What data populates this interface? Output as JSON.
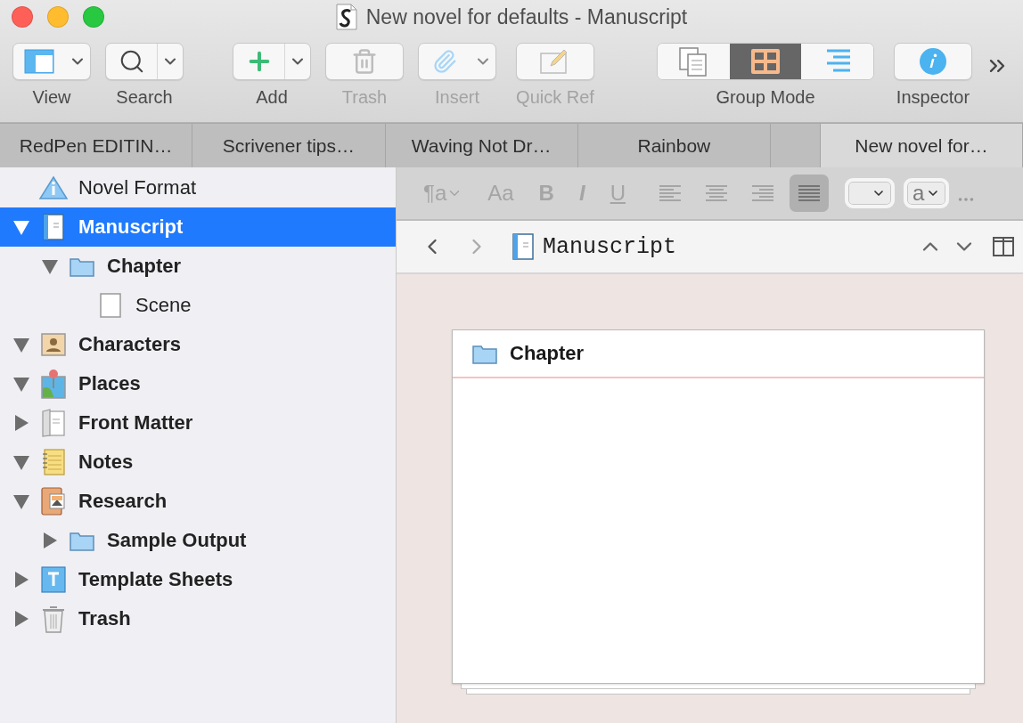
{
  "window": {
    "title": "New novel for defaults - Manuscript"
  },
  "toolbar": [
    {
      "kind": "view",
      "label": "View",
      "dropdown": true,
      "disabled": false
    },
    {
      "kind": "search",
      "label": "Search",
      "dropdown": true,
      "disabled": false
    },
    {
      "kind": "add",
      "label": "Add",
      "dropdown": true,
      "disabled": false
    },
    {
      "kind": "trash",
      "label": "Trash",
      "dropdown": false,
      "disabled": true
    },
    {
      "kind": "insert",
      "label": "Insert",
      "dropdown": true,
      "disabled": true
    },
    {
      "kind": "quickref",
      "label": "Quick Ref",
      "dropdown": false,
      "disabled": true
    },
    {
      "kind": "group",
      "label": "Group Mode",
      "segments": [
        {
          "kind": "scrivenings",
          "selected": false
        },
        {
          "kind": "corkboard",
          "selected": true
        },
        {
          "kind": "outliner",
          "selected": false
        }
      ]
    },
    {
      "kind": "inspector",
      "label": "Inspector",
      "dropdown": false,
      "disabled": false
    }
  ],
  "tabs": [
    {
      "label": "RedPen EDITIN…",
      "selected": false
    },
    {
      "label": "Scrivener tips…",
      "selected": false
    },
    {
      "label": "Waving Not Dr…",
      "selected": false
    },
    {
      "label": "Rainbow",
      "selected": false
    },
    {
      "label": "New novel for…",
      "selected": true
    }
  ],
  "binder": [
    {
      "label": "Novel Format",
      "kind": "info",
      "selected": false
    },
    {
      "label": "Manuscript",
      "kind": "manuscript",
      "expanded": true,
      "selected": true,
      "children": [
        {
          "label": "Chapter",
          "kind": "folder",
          "expanded": true,
          "selected": false,
          "children": [
            {
              "label": "Scene",
              "kind": "page",
              "selected": false
            }
          ]
        }
      ]
    },
    {
      "label": "Characters",
      "kind": "characters",
      "expanded": true,
      "selected": false
    },
    {
      "label": "Places",
      "kind": "places",
      "expanded": true,
      "selected": false
    },
    {
      "label": "Front Matter",
      "kind": "frontmatter",
      "expanded": false,
      "selected": false
    },
    {
      "label": "Notes",
      "kind": "notes",
      "expanded": true,
      "selected": false
    },
    {
      "label": "Research",
      "kind": "research",
      "expanded": true,
      "selected": false,
      "children": [
        {
          "label": "Sample Output",
          "kind": "folder",
          "expanded": false,
          "selected": false
        }
      ]
    },
    {
      "label": "Template Sheets",
      "kind": "template",
      "expanded": false,
      "selected": false
    },
    {
      "label": "Trash",
      "kind": "trash",
      "expanded": false,
      "selected": false
    }
  ],
  "format_bar": {
    "styles": [
      {
        "kind": "paragraph",
        "text": "¶a"
      },
      {
        "kind": "font",
        "text": "Aa"
      },
      {
        "kind": "bold",
        "text": "B"
      },
      {
        "kind": "italic",
        "text": "I"
      },
      {
        "kind": "underline",
        "text": "U"
      }
    ],
    "alignment": [
      {
        "kind": "left",
        "selected": false
      },
      {
        "kind": "center",
        "selected": false
      },
      {
        "kind": "right",
        "selected": false
      },
      {
        "kind": "justify",
        "selected": true
      }
    ],
    "case_popup": "a"
  },
  "header": {
    "title": "Manuscript"
  },
  "corkboard": {
    "cards": [
      {
        "title": "Chapter"
      }
    ]
  }
}
